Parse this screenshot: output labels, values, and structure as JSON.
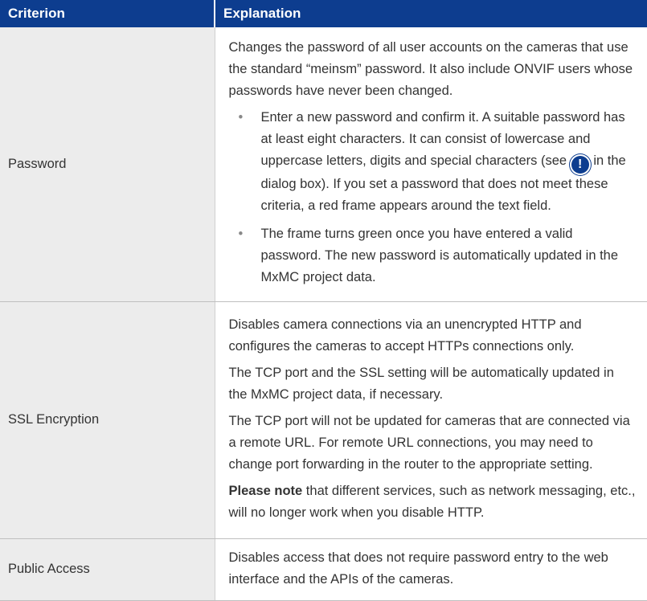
{
  "header": {
    "criterion": "Criterion",
    "explanation": "Explanation"
  },
  "rows": [
    {
      "criterion": "Password",
      "intro": "Changes the password of all user accounts on the cameras that use the standard “meinsm” password. It also include ONVIF users whose passwords have never been changed.",
      "bullet1_before": "Enter a new password and confirm it. A suitable password has at least eight characters. It can consist of lowercase and uppercase letters, digits and special characters (see",
      "bullet1_icon": "!",
      "bullet1_after": "in the dialog box). If you set a password that does not meet these criteria, a red frame appears around the text field.",
      "bullet2": "The frame turns green once you have entered a valid password. The new password is automatically updated in the MxMC project data."
    },
    {
      "criterion": "SSL Encryption",
      "p1": "Disables camera connections via an unencrypted HTTP and configures the cameras to accept HTTPs connections only.",
      "p2": "The TCP port and the SSL setting will be automatically updated in the MxMC project data, if necessary.",
      "p3": "The TCP port will not be updated for cameras that are connected via a remote URL. For remote URL connections, you may need to change port forwarding in the router to the appropriate setting.",
      "note_bold": "Please note",
      "note_rest": " that different services, such as network messaging, etc., will no longer work when you disable HTTP."
    },
    {
      "criterion": "Public Access",
      "p1": "Disables access that does not require password entry to the web interface and the APIs of the cameras."
    }
  ],
  "bullet_char": "•",
  "icons": {
    "info": "exclamation-circle-icon"
  },
  "colors": {
    "header_bg": "#0d3d8f",
    "label_bg": "#ececec"
  }
}
